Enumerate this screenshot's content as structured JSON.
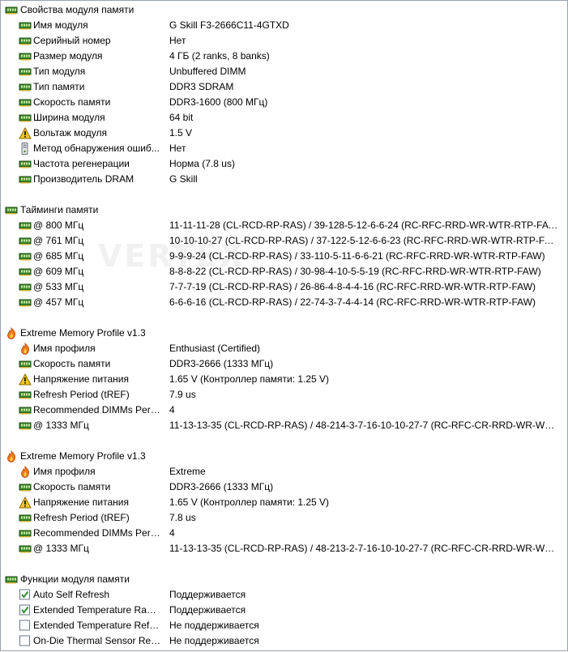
{
  "sections": [
    {
      "title": "Свойства модуля памяти",
      "icon": "memory-module-icon",
      "rows": [
        {
          "label": "Имя модуля",
          "value": "G Skill F3-2666C11-4GTXD",
          "icon": "memory-module-icon"
        },
        {
          "label": "Серийный номер",
          "value": "Нет",
          "icon": "memory-module-icon"
        },
        {
          "label": "Размер модуля",
          "value": "4 ГБ (2 ranks, 8 banks)",
          "icon": "memory-module-icon"
        },
        {
          "label": "Тип модуля",
          "value": "Unbuffered DIMM",
          "icon": "memory-module-icon"
        },
        {
          "label": "Тип памяти",
          "value": "DDR3 SDRAM",
          "icon": "memory-module-icon"
        },
        {
          "label": "Скорость памяти",
          "value": "DDR3-1600 (800 МГц)",
          "icon": "memory-module-icon"
        },
        {
          "label": "Ширина модуля",
          "value": "64 bit",
          "icon": "memory-module-icon"
        },
        {
          "label": "Вольтаж модуля",
          "value": "1.5 V",
          "icon": "warning-icon"
        },
        {
          "label": "Метод обнаружения ошиб...",
          "value": "Нет",
          "icon": "device-icon"
        },
        {
          "label": "Частота регенерации",
          "value": "Норма (7.8 us)",
          "icon": "memory-module-icon"
        },
        {
          "label": "Производитель DRAM",
          "value": "G Skill",
          "icon": "memory-module-icon"
        }
      ]
    },
    {
      "title": "Тайминги памяти",
      "icon": "memory-module-icon",
      "rows": [
        {
          "label": "@ 800 МГц",
          "value": "11-11-11-28  (CL-RCD-RP-RAS) / 39-128-5-12-6-6-24  (RC-RFC-RRD-WR-WTR-RTP-FAW)",
          "icon": "memory-module-icon"
        },
        {
          "label": "@ 761 МГц",
          "value": "10-10-10-27  (CL-RCD-RP-RAS) / 37-122-5-12-6-6-23  (RC-RFC-RRD-WR-WTR-RTP-FAW)",
          "icon": "memory-module-icon"
        },
        {
          "label": "@ 685 МГц",
          "value": "9-9-9-24  (CL-RCD-RP-RAS) / 33-110-5-11-6-6-21  (RC-RFC-RRD-WR-WTR-RTP-FAW)",
          "icon": "memory-module-icon"
        },
        {
          "label": "@ 609 МГц",
          "value": "8-8-8-22  (CL-RCD-RP-RAS) / 30-98-4-10-5-5-19  (RC-RFC-RRD-WR-WTR-RTP-FAW)",
          "icon": "memory-module-icon"
        },
        {
          "label": "@ 533 МГц",
          "value": "7-7-7-19  (CL-RCD-RP-RAS) / 26-86-4-8-4-4-16  (RC-RFC-RRD-WR-WTR-RTP-FAW)",
          "icon": "memory-module-icon"
        },
        {
          "label": "@ 457 МГц",
          "value": "6-6-6-16  (CL-RCD-RP-RAS) / 22-74-3-7-4-4-14  (RC-RFC-RRD-WR-WTR-RTP-FAW)",
          "icon": "memory-module-icon"
        }
      ]
    },
    {
      "title": "Extreme Memory Profile v1.3",
      "icon": "flame-icon",
      "rows": [
        {
          "label": "Имя профиля",
          "value": "Enthusiast (Certified)",
          "icon": "flame-icon"
        },
        {
          "label": "Скорость памяти",
          "value": "DDR3-2666 (1333 МГц)",
          "icon": "memory-module-icon"
        },
        {
          "label": "Напряжение питания",
          "value": "1.65 V  (Контроллер памяти: 1.25 V)",
          "icon": "warning-icon"
        },
        {
          "label": "Refresh Period (tREF)",
          "value": "7.9 us",
          "icon": "memory-module-icon"
        },
        {
          "label": "Recommended DIMMs Per ...",
          "value": "4",
          "icon": "memory-module-icon"
        },
        {
          "label": "@ 1333 МГц",
          "value": "11-13-13-35  (CL-RCD-RP-RAS) / 48-214-3-7-16-10-10-27-7  (RC-RFC-CR-RRD-WR-WTR-R...",
          "icon": "memory-module-icon"
        }
      ]
    },
    {
      "title": "Extreme Memory Profile v1.3",
      "icon": "flame-icon",
      "rows": [
        {
          "label": "Имя профиля",
          "value": "Extreme",
          "icon": "flame-icon"
        },
        {
          "label": "Скорость памяти",
          "value": "DDR3-2666 (1333 МГц)",
          "icon": "memory-module-icon"
        },
        {
          "label": "Напряжение питания",
          "value": "1.65 V  (Контроллер памяти: 1.25 V)",
          "icon": "warning-icon"
        },
        {
          "label": "Refresh Period (tREF)",
          "value": "7.8 us",
          "icon": "memory-module-icon"
        },
        {
          "label": "Recommended DIMMs Per ...",
          "value": "4",
          "icon": "memory-module-icon"
        },
        {
          "label": "@ 1333 МГц",
          "value": "11-13-13-35  (CL-RCD-RP-RAS) / 48-213-2-7-16-10-10-27-7  (RC-RFC-CR-RRD-WR-WTR-R...",
          "icon": "memory-module-icon"
        }
      ]
    },
    {
      "title": "Функции модуля памяти",
      "icon": "memory-module-icon",
      "rows": [
        {
          "label": "Auto Self Refresh",
          "value": "Поддерживается",
          "icon": "checkbox-checked-icon"
        },
        {
          "label": "Extended Temperature Range",
          "value": "Поддерживается",
          "icon": "checkbox-checked-icon"
        },
        {
          "label": "Extended Temperature Refre...",
          "value": "Не поддерживается",
          "icon": "checkbox-unchecked-icon"
        },
        {
          "label": "On-Die Thermal Sensor Rea...",
          "value": "Не поддерживается",
          "icon": "checkbox-unchecked-icon"
        }
      ]
    }
  ],
  "colors": {
    "module_green": "#3a8a2a",
    "module_dark": "#1d4a12",
    "warning_yellow": "#f7c52b",
    "flame_orange": "#f07a1a",
    "checkbox_border": "#6b7a8a",
    "check_green": "#2f8f2f"
  }
}
